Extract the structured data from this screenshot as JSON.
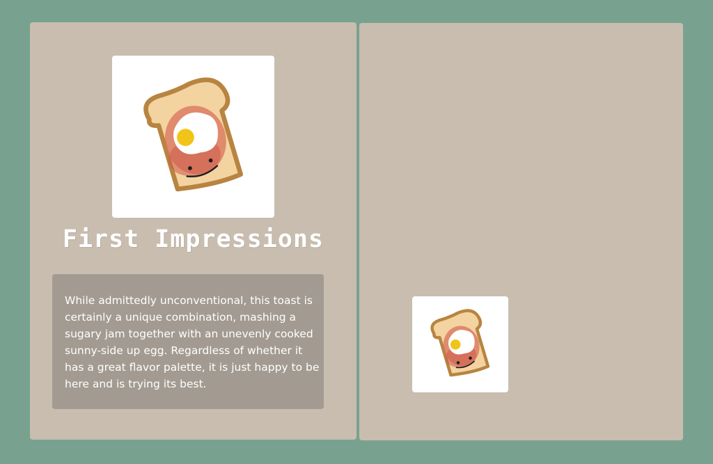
{
  "card": {
    "title": "First Impressions",
    "description": "While admittedly unconventional, this toast is certainly a unique combination, mashing a sugary jam together with an unevenly cooked sunny-side up egg. Regardless of whether it has a great flavor palette, it is just happy to be here and is trying its best.",
    "image_icon": "toast-with-jam-and-egg-icon"
  },
  "preview": {
    "image_icon": "toast-with-jam-and-egg-icon"
  },
  "colors": {
    "background": "#78a28f",
    "panel": "#c8bdaf",
    "description_box": "#a39b91",
    "text": "#ffffff"
  }
}
